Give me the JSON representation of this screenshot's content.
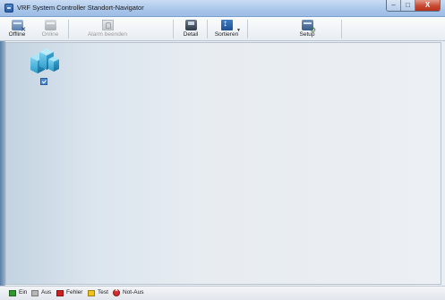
{
  "window": {
    "title": "VRF System Controller Standort-Navigator",
    "controls": {
      "minimize": "–",
      "maximize": "□",
      "close": "X"
    }
  },
  "toolbar": {
    "buttons": [
      {
        "label": "Offline",
        "icon": "offline-icon",
        "enabled": true
      },
      {
        "label": "Online",
        "icon": "online-icon",
        "enabled": false
      },
      {
        "label": "Alarm beenden",
        "icon": "alarm-icon",
        "enabled": false
      },
      {
        "label": "Detail",
        "icon": "detail-icon",
        "enabled": true
      },
      {
        "label": "Sortieren",
        "icon": "sort-icon",
        "enabled": true,
        "has_dropdown": true
      },
      {
        "label": "Setup",
        "icon": "setup-icon",
        "enabled": true
      }
    ]
  },
  "content": {
    "site_icon": "building-icon",
    "site_selected": true
  },
  "legend": [
    {
      "label": "Ein",
      "color": "#2e9a2e"
    },
    {
      "label": "Aus",
      "color": "#b8b8b8"
    },
    {
      "label": "Fehler",
      "color": "#d01f1f"
    },
    {
      "label": "Test",
      "color": "#f1c21b"
    },
    {
      "label": "Not-Aus",
      "color": "#d62b2b",
      "round": true
    }
  ]
}
